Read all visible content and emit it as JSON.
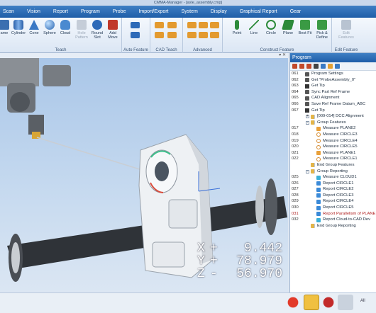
{
  "window": {
    "title": "CMMA-Manager - [axle_assembly.cmp]"
  },
  "menu": [
    "Scan",
    "Vision",
    "Report",
    "Program",
    "Probe",
    "Import/Export",
    "System",
    "Display",
    "Graphical Report",
    "Gear"
  ],
  "ribbon": {
    "teach_group": {
      "label": "Teach",
      "buttons": [
        "ame",
        "Cylinder",
        "Cone",
        "Sphere",
        "Cloud",
        "Hole Pattern",
        "Round Slot",
        "Add Move"
      ]
    },
    "auto_feature_group": {
      "label": "Auto Feature"
    },
    "cad_teach_group": {
      "label": "CAD Teach"
    },
    "advanced_group": {
      "label": "Advanced"
    },
    "construct_group": {
      "label": "Construct Feature",
      "buttons": [
        "Point",
        "Line",
        "Circle",
        "Plane",
        "Best Fit",
        "Pick & Define"
      ]
    },
    "edit_group": {
      "label": "Edit Feature",
      "buttons": [
        "Edit Features"
      ]
    }
  },
  "coordinates": [
    {
      "axis": "X",
      "sign": "+",
      "value": "9.442"
    },
    {
      "axis": "Y",
      "sign": "+",
      "value": "78.979"
    },
    {
      "axis": "Z",
      "sign": "-",
      "value": "56.970"
    }
  ],
  "program_panel": {
    "title": "Program",
    "rows": [
      {
        "n": "061",
        "text": "Program Settings",
        "icon": "gen",
        "indent": 0
      },
      {
        "n": "062",
        "text": "Get \"ProbeAssembly_0\"",
        "icon": "gen",
        "indent": 0
      },
      {
        "n": "063",
        "text": "Get Tip",
        "icon": "tip",
        "indent": 0
      },
      {
        "n": "064",
        "text": "Sync Part Ref Frame",
        "icon": "gen",
        "indent": 0
      },
      {
        "n": "065",
        "text": "CAD Alignment",
        "icon": "gen",
        "indent": 0
      },
      {
        "n": "066",
        "text": "Save Ref Frame Datum_ABC",
        "icon": "gen",
        "indent": 0
      },
      {
        "n": "067",
        "text": "Get Tip",
        "icon": "tip",
        "indent": 0
      },
      {
        "n": "",
        "text": "[009-014] DCC Alignment",
        "icon": "grp",
        "indent": 1,
        "toggle": "+"
      },
      {
        "n": "",
        "text": "Group Features",
        "icon": "grp",
        "indent": 1,
        "toggle": "-"
      },
      {
        "n": "017",
        "text": "Measure PLANE2",
        "icon": "plane",
        "indent": 2
      },
      {
        "n": "018",
        "text": "Measure CIRCLE3",
        "icon": "circ",
        "indent": 2
      },
      {
        "n": "019",
        "text": "Measure CIRCLE4",
        "icon": "circ",
        "indent": 2
      },
      {
        "n": "020",
        "text": "Measure CIRCLE5",
        "icon": "circ",
        "indent": 2
      },
      {
        "n": "021",
        "text": "Measure PLANE1",
        "icon": "plane",
        "indent": 2
      },
      {
        "n": "022",
        "text": "Measure CIRCLE1",
        "icon": "circ",
        "indent": 2
      },
      {
        "n": "",
        "text": "End Group Features",
        "icon": "grp",
        "indent": 1
      },
      {
        "n": "",
        "text": "Group Reporting",
        "icon": "grp",
        "indent": 1,
        "toggle": "-"
      },
      {
        "n": "025",
        "text": "Measure CLOUD1",
        "icon": "cyan",
        "indent": 2
      },
      {
        "n": "026",
        "text": "Report CIRCLE1",
        "icon": "rep",
        "indent": 2
      },
      {
        "n": "027",
        "text": "Report CIRCLE2",
        "icon": "rep",
        "indent": 2
      },
      {
        "n": "028",
        "text": "Report CIRCLE3",
        "icon": "rep",
        "indent": 2
      },
      {
        "n": "029",
        "text": "Report CIRCLE4",
        "icon": "rep",
        "indent": 2
      },
      {
        "n": "030",
        "text": "Report CIRCLE5",
        "icon": "rep",
        "indent": 2
      },
      {
        "n": "031",
        "text": "Report Parallelism of PLANE",
        "icon": "rep",
        "indent": 2,
        "highlight": true
      },
      {
        "n": "032",
        "text": "Report Cloud-to-CAD Dev",
        "icon": "cyan",
        "indent": 2
      },
      {
        "n": "",
        "text": "End Group Reporting",
        "icon": "grp",
        "indent": 1
      }
    ]
  },
  "status": {
    "right_text": "All"
  },
  "colors": {
    "menu_bar": "#1f5ea8",
    "highlight_text": "#b02020"
  }
}
